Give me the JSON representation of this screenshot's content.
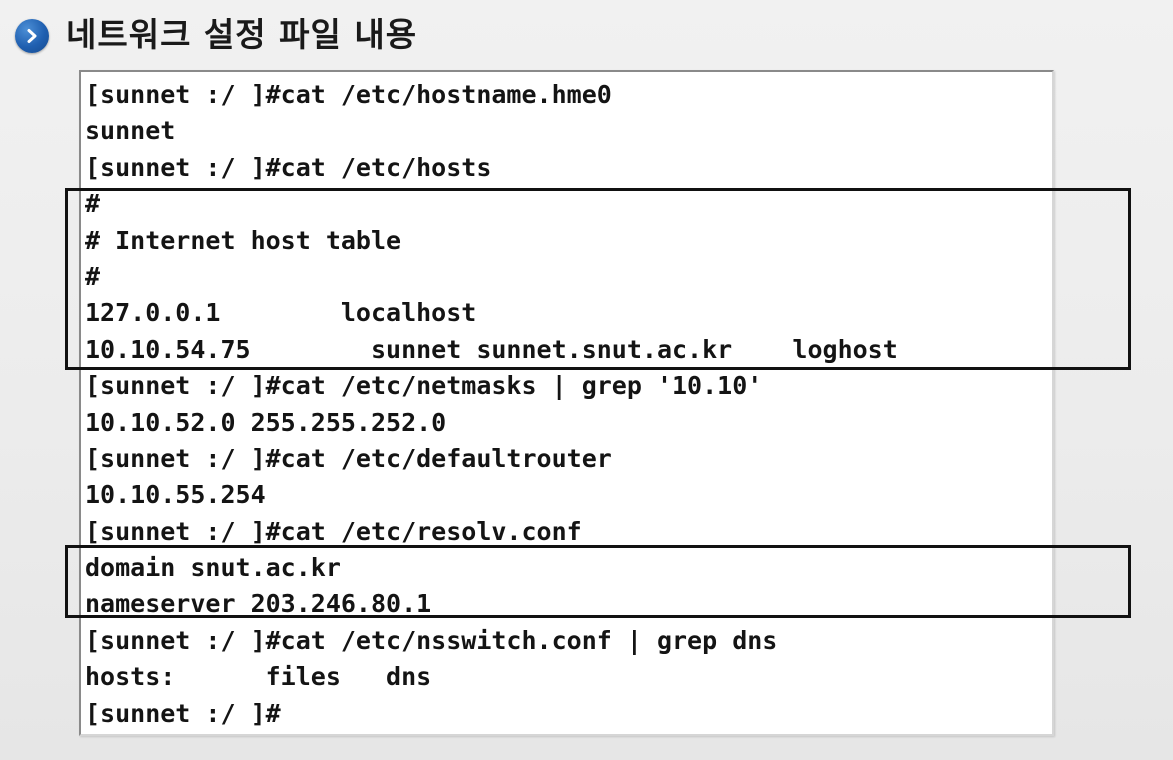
{
  "slide": {
    "bullet_icon": "chevron-right-icon",
    "title": "네트워크 설정 파일 내용",
    "accent_color": "#1f5fb0"
  },
  "terminal": {
    "lines": [
      "[sunnet :/ ]#cat /etc/hostname.hme0",
      "sunnet",
      "[sunnet :/ ]#cat /etc/hosts",
      "#",
      "# Internet host table",
      "#",
      "127.0.0.1        localhost",
      "10.10.54.75        sunnet sunnet.snut.ac.kr    loghost",
      "[sunnet :/ ]#cat /etc/netmasks | grep '10.10'",
      "10.10.52.0 255.255.252.0",
      "[sunnet :/ ]#cat /etc/defaultrouter",
      "10.10.55.254",
      "[sunnet :/ ]#cat /etc/resolv.conf",
      "domain snut.ac.kr",
      "nameserver 203.246.80.1",
      "[sunnet :/ ]#cat /etc/nsswitch.conf | grep dns",
      "hosts:      files   dns",
      "[sunnet :/ ]#"
    ]
  }
}
